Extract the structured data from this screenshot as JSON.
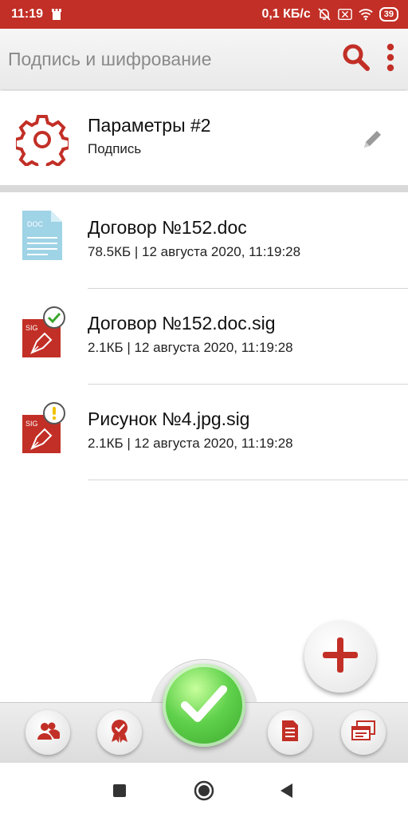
{
  "status_bar": {
    "time": "11:19",
    "speed": "0,1 КБ/с",
    "battery": "39"
  },
  "toolbar": {
    "title": "Подпись и шифрование",
    "search_icon": "search-icon",
    "more_icon": "more-vertical-icon"
  },
  "params": {
    "name": "Параметры #2",
    "subtitle": "Подпись",
    "icon": "gear-icon",
    "edit_icon": "pencil-icon"
  },
  "files": [
    {
      "name": "Договор №152.doc",
      "meta": "78.5КБ | 12 августа 2020, 11:19:28",
      "icon": "doc-file-icon",
      "badge": "DOC"
    },
    {
      "name": "Договор №152.doc.sig",
      "meta": "2.1КБ | 12 августа 2020, 11:19:28",
      "icon": "sig-file-valid-icon",
      "badge": "SIG"
    },
    {
      "name": "Рисунок №4.jpg.sig",
      "meta": "2.1КБ | 12 августа 2020, 11:19:28",
      "icon": "sig-file-warning-icon",
      "badge": "SIG"
    }
  ],
  "fab": {
    "icon": "plus-icon"
  },
  "bottom_bar": {
    "items": [
      "contacts-icon",
      "certificate-icon",
      "check-icon",
      "document-icon",
      "windows-icon"
    ]
  },
  "colors": {
    "accent": "#c22f26",
    "valid": "#3aa62c",
    "warning": "#f2c200",
    "doc_blue": "#9fd3e6"
  }
}
